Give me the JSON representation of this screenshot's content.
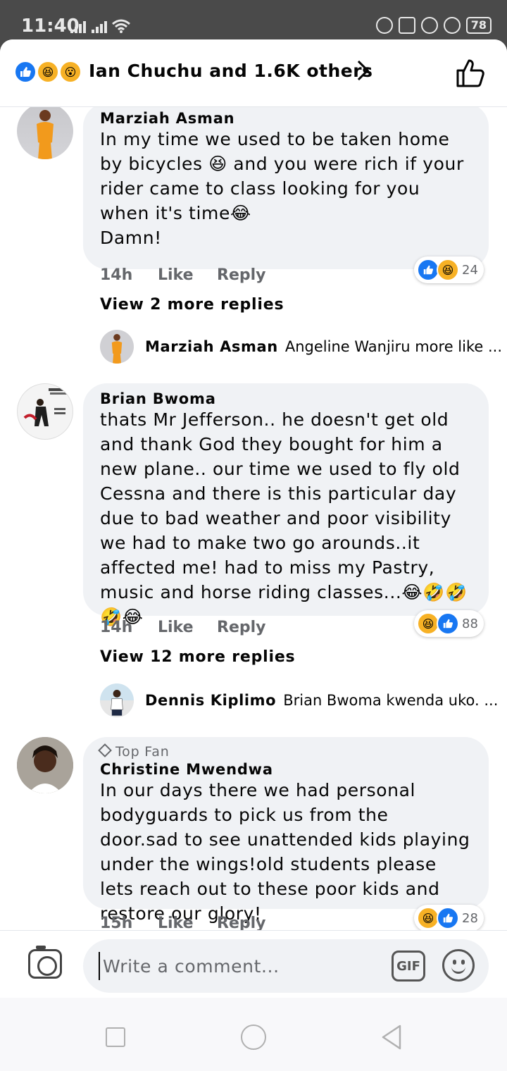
{
  "status_bar": {
    "time": "11:40",
    "battery": "78"
  },
  "header": {
    "reactions": [
      "like",
      "haha",
      "wow"
    ],
    "reacted_by": "Ian Chuchu and 1.6K others"
  },
  "comments": [
    {
      "author": "Marziah Asman",
      "top_fan": false,
      "text": "In my time we used to be taken home by bicycles 😆 and you were rich if your rider came to class looking for you when it's time😂\nDamn!",
      "time": "14h",
      "like_label": "Like",
      "reply_label": "Reply",
      "reactions": [
        "like",
        "haha"
      ],
      "reaction_count": "24",
      "more_replies": "View 2 more replies",
      "preview_author": "Marziah Asman",
      "preview_text": "Angeline Wanjiru more like ..."
    },
    {
      "author": "Brian Bwoma",
      "top_fan": false,
      "text": "thats Mr Jefferson.. he doesn't get old and thank God they bought for him a new plane.. our time we used to fly old Cessna and there is this particular day due to bad weather and poor visibility we had to make two go arounds..it affected me! had to miss my Pastry, music and horse riding classes...😂🤣🤣🤣😂",
      "time": "14h",
      "like_label": "Like",
      "reply_label": "Reply",
      "reactions": [
        "haha",
        "like"
      ],
      "reaction_count": "88",
      "more_replies": "View 12 more replies",
      "preview_author": "Dennis Kiplimo",
      "preview_text": "Brian Bwoma kwenda uko. ..."
    },
    {
      "author": "Christine Mwendwa",
      "top_fan": true,
      "top_fan_label": "Top Fan",
      "text": "In our days there we had personal bodyguards to pick us from the door.sad to see unattended kids playing under the wings!old students please lets reach out to these poor kids and restore our glory!",
      "time": "15h",
      "like_label": "Like",
      "reply_label": "Reply",
      "reactions": [
        "haha",
        "like"
      ],
      "reaction_count": "28"
    }
  ],
  "composer": {
    "placeholder": "Write a comment...",
    "gif_label": "GIF"
  },
  "colors": {
    "accent": "#1877f2",
    "bubble": "#f0f2f5",
    "secondary_text": "#65676b",
    "haha": "#f7b125"
  }
}
